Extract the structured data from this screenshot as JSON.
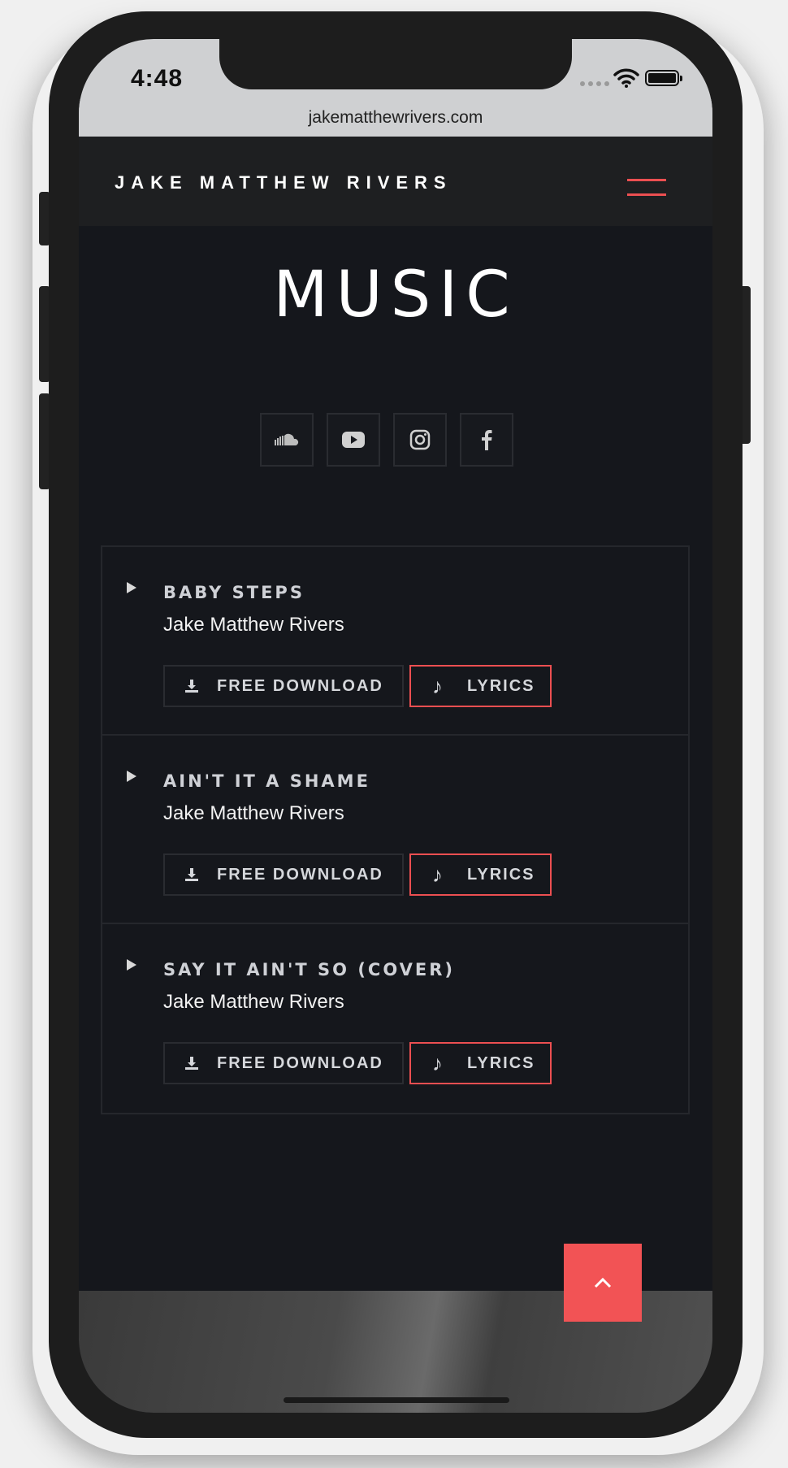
{
  "status": {
    "time": "4:48"
  },
  "browser": {
    "url": "jakematthewrivers.com"
  },
  "header": {
    "site_title": "JAKE MATTHEW RIVERS"
  },
  "page": {
    "title": "MUSIC"
  },
  "socials": [
    "soundcloud-icon",
    "youtube-icon",
    "instagram-icon",
    "facebook-icon"
  ],
  "tracks": [
    {
      "title": "BABY STEPS",
      "artist": "Jake Matthew Rivers",
      "download_label": "FREE DOWNLOAD",
      "lyrics_label": "LYRICS"
    },
    {
      "title": "AIN'T IT A SHAME",
      "artist": "Jake Matthew Rivers",
      "download_label": "FREE DOWNLOAD",
      "lyrics_label": "LYRICS"
    },
    {
      "title": "SAY IT AIN'T SO (COVER)",
      "artist": "Jake Matthew Rivers",
      "download_label": "FREE DOWNLOAD",
      "lyrics_label": "LYRICS"
    }
  ],
  "colors": {
    "accent": "#f25355",
    "background": "#15171c",
    "header": "#1e1f21"
  }
}
